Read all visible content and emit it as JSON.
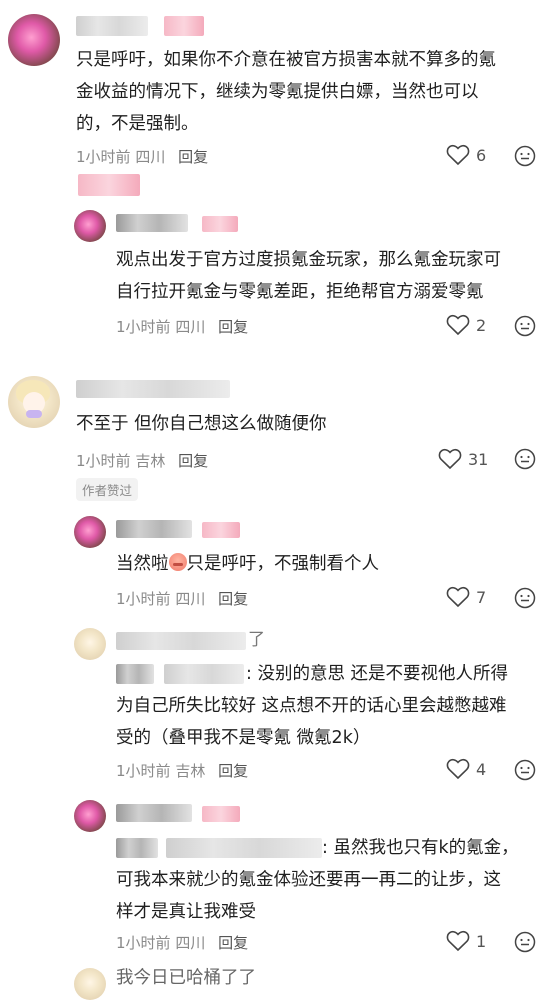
{
  "comments": [
    {
      "text_lines": [
        "只是呼吁，如果你不介意在被官方损害本就不算多的氪",
        "金收益的情况下，继续为零氪提供白嫖，当然也可以",
        "的，不是强制。"
      ],
      "time": "1小时前",
      "location": "四川",
      "reply_label": "回复",
      "likes": "6"
    },
    {
      "text_lines": [
        "观点出发于官方过度损氪金玩家，那么氪金玩家可",
        "自行拉开氪金与零氪差距，拒绝帮官方溺爱零氪"
      ],
      "time": "1小时前",
      "location": "四川",
      "reply_label": "回复",
      "likes": "2"
    },
    {
      "text_lines": [
        "不至于 但你自己想这么做随便你"
      ],
      "time": "1小时前",
      "location": "吉林",
      "reply_label": "回复",
      "likes": "31",
      "badge": "作者赞过"
    },
    {
      "text_before": "当然啦",
      "text_after": "只是呼吁，不强制看个人",
      "time": "1小时前",
      "location": "四川",
      "reply_label": "回复",
      "likes": "7"
    },
    {
      "name_suffix": "了",
      "text_lines": [
        ": 没别的意思 还是不要视他人所得",
        "为自己所失比较好 这点想不开的话心里会越憋越难",
        "受的（叠甲我不是零氪 微氪2k）"
      ],
      "time": "1小时前",
      "location": "吉林",
      "reply_label": "回复",
      "likes": "4"
    },
    {
      "text_lines": ": 虽然我也只有k的氪金，",
      "text_lines_more": [
        "可我本来就少的氪金体验还要再一再二的让步，这",
        "样才是真让我难受"
      ],
      "time": "1小时前",
      "location": "四川",
      "reply_label": "回复",
      "likes": "1"
    }
  ],
  "partial_bottom_text": "我今日已哈桶了了"
}
